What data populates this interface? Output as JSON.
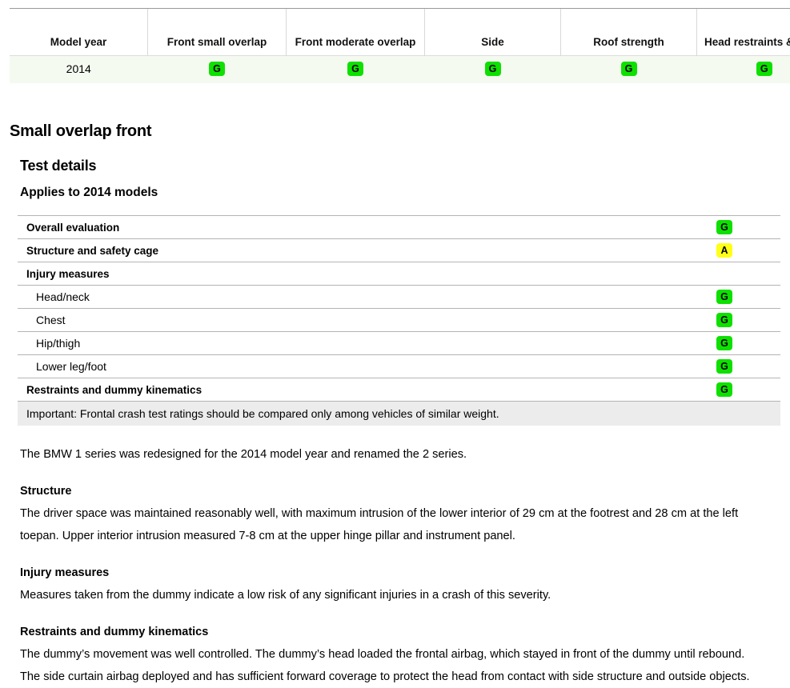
{
  "ratings_table": {
    "columns": [
      "Model year",
      "Front small overlap",
      "Front moderate overlap",
      "Side",
      "Roof strength",
      "Head restraints & seats"
    ],
    "rows": [
      {
        "model_year": "2014",
        "front_small_overlap": "G",
        "front_moderate_overlap": "G",
        "side": "G",
        "roof_strength": "G",
        "head_restraints_seats": "G"
      }
    ]
  },
  "section": {
    "title": "Small overlap front",
    "subtitle": "Test details",
    "applies_to": "Applies to 2014 models"
  },
  "details": {
    "rows": [
      {
        "label": "Overall evaluation",
        "rating": "G",
        "sub": false
      },
      {
        "label": "Structure and safety cage",
        "rating": "A",
        "sub": false
      },
      {
        "label": "Injury measures",
        "rating": "",
        "sub": false
      },
      {
        "label": "Head/neck",
        "rating": "G",
        "sub": true
      },
      {
        "label": "Chest",
        "rating": "G",
        "sub": true
      },
      {
        "label": "Hip/thigh",
        "rating": "G",
        "sub": true
      },
      {
        "label": "Lower leg/foot",
        "rating": "G",
        "sub": true
      },
      {
        "label": "Restraints and dummy kinematics",
        "rating": "G",
        "sub": false
      }
    ],
    "note": "Important: Frontal crash test ratings should be compared only among vehicles of similar weight."
  },
  "body": {
    "intro": "The BMW 1 series was redesigned for the 2014 model year and renamed the 2 series.",
    "blocks": [
      {
        "heading": "Structure",
        "text": "The driver space was maintained reasonably well, with maximum intrusion of the lower interior of 29 cm at the footrest and 28 cm at the left toepan. Upper interior intrusion measured 7-8 cm at the upper hinge pillar and instrument panel."
      },
      {
        "heading": "Injury measures",
        "text": "Measures taken from the dummy indicate a low risk of any significant injuries in a crash of this severity."
      },
      {
        "heading": "Restraints and dummy kinematics",
        "text": "The dummy’s movement was well controlled. The dummy’s head loaded the frontal airbag, which stayed in front of the dummy until rebound. The side curtain airbag deployed and has sufficient forward coverage to protect the head from contact with side structure and outside objects."
      }
    ]
  },
  "rating_colors": {
    "good": "#0ee000",
    "acceptable": "#ffff17",
    "marginal": "#ffa500",
    "poor": "#ff2a2a"
  }
}
